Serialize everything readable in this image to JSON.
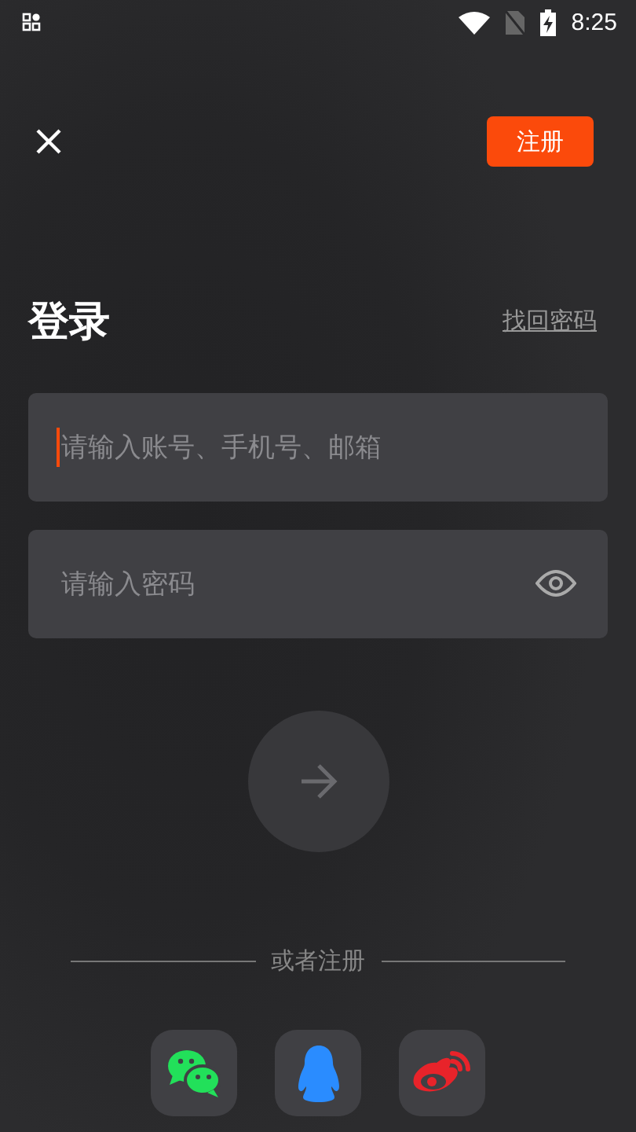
{
  "status_bar": {
    "time": "8:25"
  },
  "top_bar": {
    "register_button": "注册"
  },
  "title": "登录",
  "forgot_link": "找回密码",
  "fields": [
    {
      "kind": "account",
      "placeholder": "请输入账号、手机号、邮箱",
      "focused": true
    },
    {
      "kind": "password",
      "placeholder": "请输入密码",
      "focused": false
    }
  ],
  "submit": {
    "disabled": true
  },
  "divider_text": "或者注册",
  "social": [
    {
      "kind": "chat"
    },
    {
      "kind": "penguin"
    },
    {
      "kind": "eye"
    }
  ]
}
